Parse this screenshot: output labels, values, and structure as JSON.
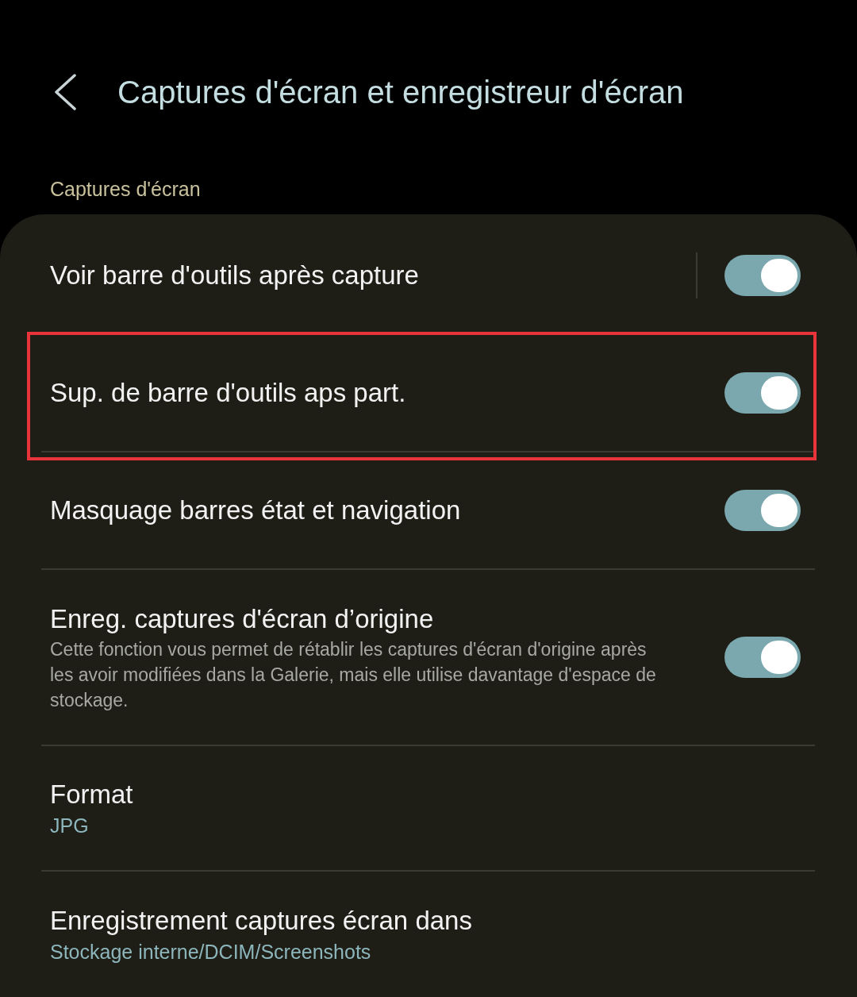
{
  "header": {
    "title": "Captures d'écran et enregistreur d'écran"
  },
  "section": {
    "label": "Captures d'écran"
  },
  "rows": [
    {
      "kind": "toggle",
      "title": "Voir barre d'outils après capture",
      "on": true,
      "split": true,
      "highlighted": false
    },
    {
      "kind": "toggle",
      "title": "Sup. de barre d'outils aps part.",
      "on": true,
      "split": false,
      "highlighted": true
    },
    {
      "kind": "toggle",
      "title": "Masquage barres état et navigation",
      "on": true,
      "split": false,
      "highlighted": false
    },
    {
      "kind": "toggle",
      "title": "Enreg. captures d'écran d’origine",
      "description": "Cette fonction vous permet de rétablir les captures d'écran d'origine après les avoir modifiées dans la Galerie, mais elle utilise davantage d'espace de stockage.",
      "on": true,
      "split": false,
      "highlighted": false
    },
    {
      "kind": "value",
      "title": "Format",
      "value": "JPG"
    },
    {
      "kind": "value",
      "title": "Enregistrement captures écran dans",
      "value": "Stockage interne/DCIM/Screenshots"
    }
  ]
}
